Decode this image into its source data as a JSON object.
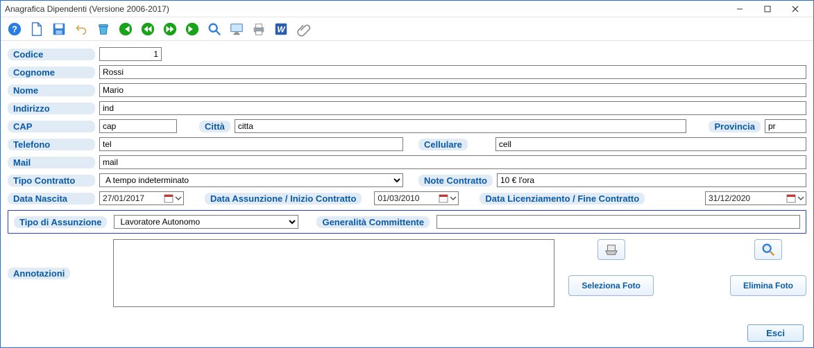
{
  "window": {
    "title": "Anagrafica Dipendenti (Versione 2006-2017)"
  },
  "labels": {
    "codice": "Codice",
    "cognome": "Cognome",
    "nome": "Nome",
    "indirizzo": "Indirizzo",
    "cap": "CAP",
    "citta": "Città",
    "provincia": "Provincia",
    "telefono": "Telefono",
    "cellulare": "Cellulare",
    "mail": "Mail",
    "tipo_contratto": "Tipo Contratto",
    "note_contratto": "Note Contratto",
    "data_nascita": "Data Nascita",
    "data_assunzione": "Data Assunzione / Inizio Contratto",
    "data_licenziamento": "Data Licenziamento / Fine Contratto",
    "tipo_assunzione": "Tipo di Assunzione",
    "generalita": "Generalità Committente",
    "annotazioni": "Annotazioni"
  },
  "values": {
    "codice": "1",
    "cognome": "Rossi",
    "nome": "Mario",
    "indirizzo": "ind",
    "cap": "cap",
    "citta": "citta",
    "provincia": "pr",
    "telefono": "tel",
    "cellulare": "cell",
    "mail": "mail",
    "tipo_contratto": "A tempo indeterminato",
    "note_contratto": "10 € l'ora",
    "data_nascita": "27/01/2017",
    "data_assunzione": "01/03/2010",
    "data_licenziamento": "31/12/2020",
    "tipo_assunzione": "Lavoratore Autonomo",
    "generalita": "",
    "annotazioni": ""
  },
  "buttons": {
    "seleziona_foto": "Seleziona Foto",
    "elimina_foto": "Elimina Foto",
    "esci": "Esci"
  },
  "icons": {
    "help": "help-icon",
    "new": "new-doc-icon",
    "save": "save-icon",
    "undo": "undo-icon",
    "delete": "trash-icon",
    "first": "first-record-icon",
    "prev": "prev-record-icon",
    "next": "next-record-icon",
    "last": "last-record-icon",
    "search": "search-icon",
    "monitor": "monitor-icon",
    "print": "print-icon",
    "word": "word-icon",
    "attach": "paperclip-icon",
    "scanner": "scanner-icon",
    "zoom": "magnifier-icon"
  },
  "colors": {
    "label_bg": "#e1ebf5",
    "label_fg": "#0a5aa8",
    "window_border": "#2a6fd1",
    "nav_green": "#19a319"
  }
}
